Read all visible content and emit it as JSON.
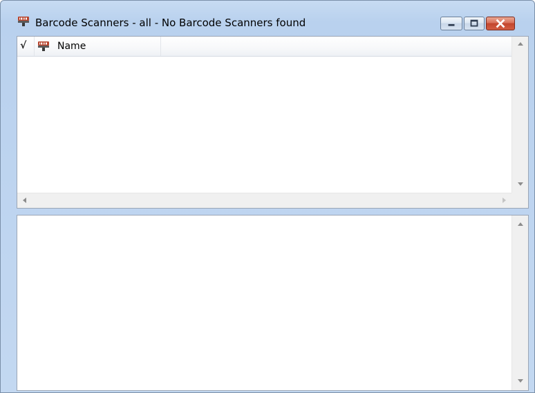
{
  "window": {
    "title": "Barcode Scanners - all - No Barcode Scanners found",
    "icon": "barcode-scanner-icon",
    "caption_buttons": [
      "minimize-icon",
      "maximize-icon",
      "close-icon"
    ],
    "colors": {
      "titlebar": "#b9d1ee",
      "close": "#c2452d",
      "frame_border": "#7a8fa8"
    }
  },
  "list": {
    "columns": {
      "check": "√",
      "name_label": "Name",
      "name_icon": "barcode-scanner-icon"
    },
    "rows": []
  },
  "detail": {
    "text": ""
  }
}
